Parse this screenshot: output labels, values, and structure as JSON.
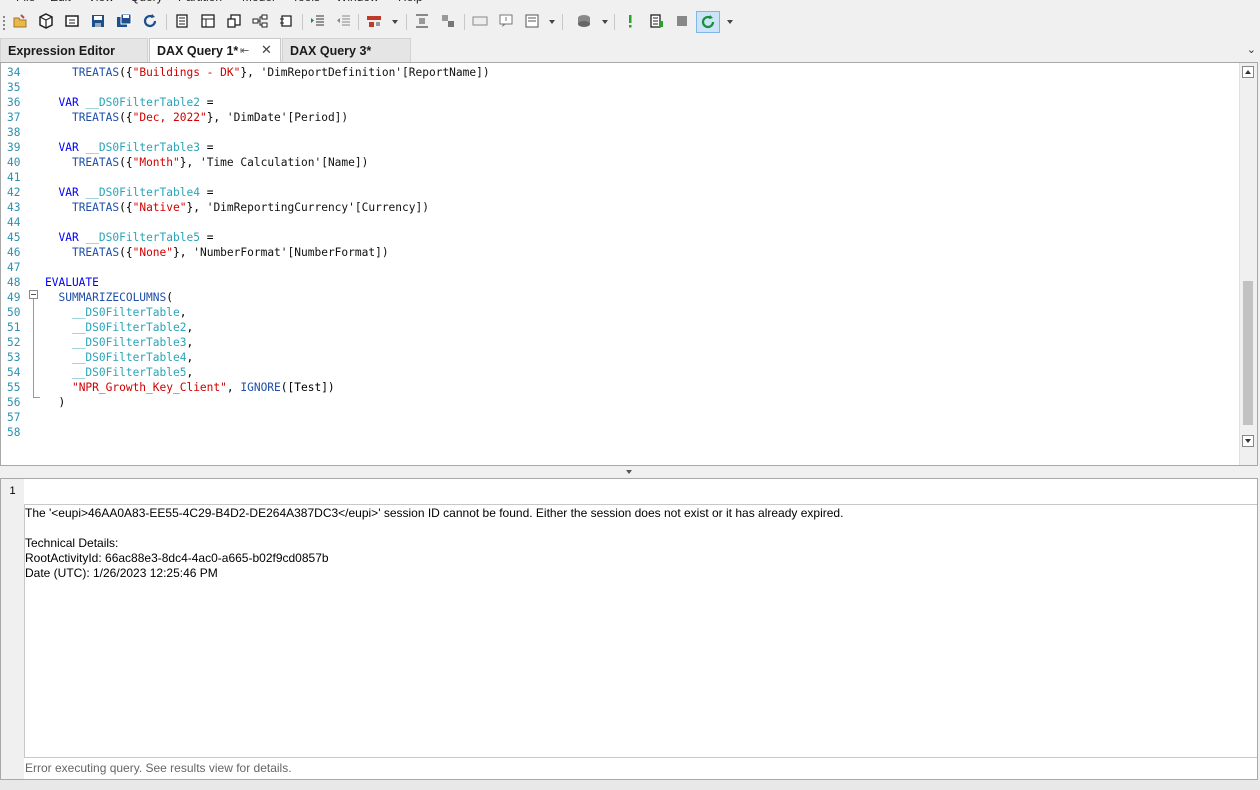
{
  "menu": [
    "File",
    "Edit",
    "View",
    "Query",
    "Partition",
    "Model",
    "Tools",
    "Window",
    "Help"
  ],
  "toolbar": {
    "icons": [
      "open-icon",
      "cube-icon",
      "cube-tools-icon",
      "save-icon",
      "save-all-icon",
      "refresh-icon",
      "document-icon",
      "table-icon",
      "copy-icon",
      "hierarchy-icon",
      "relationship-icon",
      "indent-icon",
      "outdent-icon",
      "model-icon",
      "align-icon",
      "deploy-icon",
      "window-icon",
      "comment-icon",
      "select-icon",
      "cube-small-icon",
      "run-icon",
      "results-icon",
      "stop-icon",
      "refresh-query-icon"
    ]
  },
  "tabs": [
    {
      "label": "Expression Editor",
      "active": false
    },
    {
      "label": "DAX Query 1*",
      "active": true,
      "pin": "⇤",
      "close": "✕"
    },
    {
      "label": "DAX Query 3*",
      "active": false
    }
  ],
  "editor": {
    "lines": [
      {
        "n": "34",
        "tokens": [
          [
            "plain",
            "    "
          ],
          [
            "fn",
            "TREATAS"
          ],
          [
            "plain",
            "({"
          ],
          [
            "str",
            "\"Buildings - DK\""
          ],
          [
            "plain",
            "}, "
          ],
          [
            "tbl",
            "'DimReportDefinition'[ReportName])"
          ]
        ]
      },
      {
        "n": "35",
        "tokens": []
      },
      {
        "n": "36",
        "tokens": [
          [
            "plain",
            "  "
          ],
          [
            "kw",
            "VAR"
          ],
          [
            "plain",
            " "
          ],
          [
            "var",
            "__DS0FilterTable2"
          ],
          [
            "plain",
            " ="
          ]
        ]
      },
      {
        "n": "37",
        "tokens": [
          [
            "plain",
            "    "
          ],
          [
            "fn",
            "TREATAS"
          ],
          [
            "plain",
            "({"
          ],
          [
            "str",
            "\"Dec, 2022\""
          ],
          [
            "plain",
            "}, "
          ],
          [
            "tbl",
            "'DimDate'[Period])"
          ]
        ]
      },
      {
        "n": "38",
        "tokens": []
      },
      {
        "n": "39",
        "tokens": [
          [
            "plain",
            "  "
          ],
          [
            "kw",
            "VAR"
          ],
          [
            "plain",
            " "
          ],
          [
            "var",
            "__DS0FilterTable3"
          ],
          [
            "plain",
            " ="
          ]
        ]
      },
      {
        "n": "40",
        "tokens": [
          [
            "plain",
            "    "
          ],
          [
            "fn",
            "TREATAS"
          ],
          [
            "plain",
            "({"
          ],
          [
            "str",
            "\"Month\""
          ],
          [
            "plain",
            "}, "
          ],
          [
            "tbl",
            "'Time Calculation'[Name])"
          ]
        ]
      },
      {
        "n": "41",
        "tokens": []
      },
      {
        "n": "42",
        "tokens": [
          [
            "plain",
            "  "
          ],
          [
            "kw",
            "VAR"
          ],
          [
            "plain",
            " "
          ],
          [
            "var",
            "__DS0FilterTable4"
          ],
          [
            "plain",
            " ="
          ]
        ]
      },
      {
        "n": "43",
        "tokens": [
          [
            "plain",
            "    "
          ],
          [
            "fn",
            "TREATAS"
          ],
          [
            "plain",
            "({"
          ],
          [
            "str",
            "\"Native\""
          ],
          [
            "plain",
            "}, "
          ],
          [
            "tbl",
            "'DimReportingCurrency'[Currency])"
          ]
        ]
      },
      {
        "n": "44",
        "tokens": []
      },
      {
        "n": "45",
        "tokens": [
          [
            "plain",
            "  "
          ],
          [
            "kw",
            "VAR"
          ],
          [
            "plain",
            " "
          ],
          [
            "var",
            "__DS0FilterTable5"
          ],
          [
            "plain",
            " ="
          ]
        ]
      },
      {
        "n": "46",
        "tokens": [
          [
            "plain",
            "    "
          ],
          [
            "fn",
            "TREATAS"
          ],
          [
            "plain",
            "({"
          ],
          [
            "str",
            "\"None\""
          ],
          [
            "plain",
            "}, "
          ],
          [
            "tbl",
            "'NumberFormat'[NumberFormat])"
          ]
        ]
      },
      {
        "n": "47",
        "tokens": []
      },
      {
        "n": "48",
        "tokens": [
          [
            "kw",
            "EVALUATE"
          ]
        ]
      },
      {
        "n": "49",
        "tokens": [
          [
            "plain",
            "  "
          ],
          [
            "fn",
            "SUMMARIZECOLUMNS"
          ],
          [
            "plain",
            "("
          ]
        ]
      },
      {
        "n": "50",
        "tokens": [
          [
            "plain",
            "    "
          ],
          [
            "var",
            "__DS0FilterTable"
          ],
          [
            "plain",
            ","
          ]
        ]
      },
      {
        "n": "51",
        "tokens": [
          [
            "plain",
            "    "
          ],
          [
            "var",
            "__DS0FilterTable2"
          ],
          [
            "plain",
            ","
          ]
        ]
      },
      {
        "n": "52",
        "tokens": [
          [
            "plain",
            "    "
          ],
          [
            "var",
            "__DS0FilterTable3"
          ],
          [
            "plain",
            ","
          ]
        ]
      },
      {
        "n": "53",
        "tokens": [
          [
            "plain",
            "    "
          ],
          [
            "var",
            "__DS0FilterTable4"
          ],
          [
            "plain",
            ","
          ]
        ]
      },
      {
        "n": "54",
        "tokens": [
          [
            "plain",
            "    "
          ],
          [
            "var",
            "__DS0FilterTable5"
          ],
          [
            "plain",
            ","
          ]
        ]
      },
      {
        "n": "55",
        "tokens": [
          [
            "plain",
            "    "
          ],
          [
            "str",
            "\"NPR_Growth_Key_Client\""
          ],
          [
            "plain",
            ", "
          ],
          [
            "fn",
            "IGNORE"
          ],
          [
            "plain",
            "([Test])"
          ]
        ]
      },
      {
        "n": "56",
        "tokens": [
          [
            "plain",
            "  )"
          ]
        ]
      },
      {
        "n": "57",
        "tokens": []
      },
      {
        "n": "58",
        "tokens": []
      }
    ]
  },
  "results": {
    "row_number": "1",
    "messages": [
      "The '<eupi>46AA0A83-EE55-4C29-B4D2-DE264A387DC3</eupi>' session ID cannot be found. Either the session does not exist or it has already expired.",
      "",
      "Technical Details:",
      "RootActivityId: 66ac88e3-8dc4-4ac0-a665-b02f9cd0857b",
      "Date (UTC): 1/26/2023 12:25:46 PM"
    ],
    "status": "Error executing query. See results view for details."
  }
}
